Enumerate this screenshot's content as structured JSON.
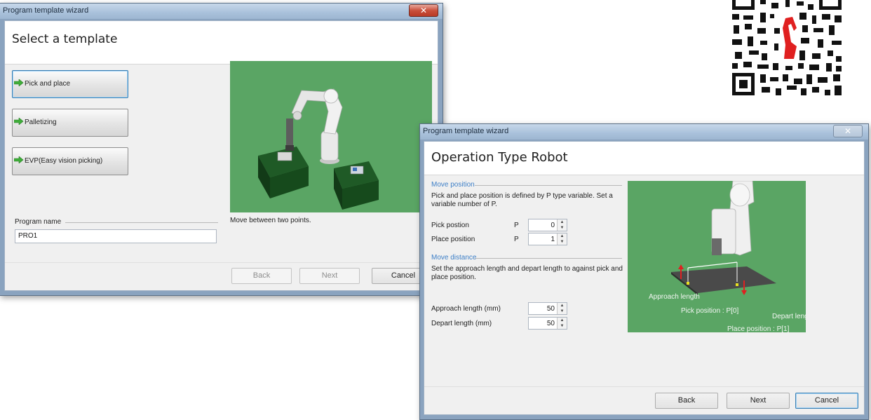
{
  "window1": {
    "title": "Program template wizard",
    "close_glyph": "✕",
    "heading": "Select a template",
    "templates": [
      {
        "label": "Pick and place",
        "icon": "green-arrow-icon"
      },
      {
        "label": "Palletizing",
        "icon": "green-arrow-icon"
      },
      {
        "label": "EVP(Easy vision picking)",
        "icon": "green-arrow-icon"
      }
    ],
    "preview_caption": "Move between two points.",
    "program_name_label": "Program name",
    "program_name_value": "PRO1",
    "buttons": {
      "back": "Back",
      "next": "Next",
      "cancel": "Cancel"
    }
  },
  "window2": {
    "title": "Program template wizard",
    "close_glyph": "✕",
    "heading": "Operation Type Robot",
    "move_position": {
      "title": "Move position",
      "description": "Pick and place position is defined by P type variable. Set a variable number of P.",
      "pick_label": "Pick postion",
      "pick_var": "P",
      "pick_value": "0",
      "place_label": "Place position",
      "place_var": "P",
      "place_value": "1"
    },
    "move_distance": {
      "title": "Move distance",
      "description": "Set the approach length and depart length to against pick and place position.",
      "approach_label": "Approach length (mm)",
      "approach_value": "50",
      "depart_label": "Depart length (mm)",
      "depart_value": "50"
    },
    "preview_labels": {
      "approach": "Approach length",
      "pick": "Pick position : P[0]",
      "depart": "Depart leng",
      "place": "Place position : P[1]"
    },
    "buttons": {
      "back": "Back",
      "next": "Next",
      "cancel": "Cancel"
    }
  },
  "colors": {
    "preview_green": "#5aa564",
    "accent_blue": "#3d7fc7",
    "qr_red": "#e02020"
  }
}
